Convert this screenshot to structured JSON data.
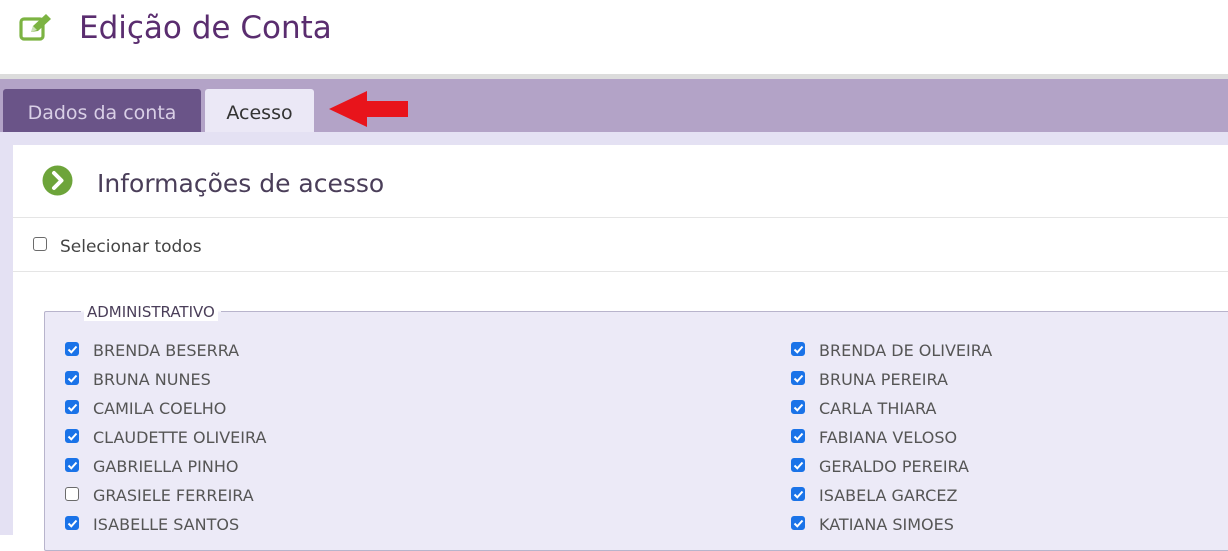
{
  "header": {
    "title": "Edição de Conta",
    "icon": "edit-icon"
  },
  "tabs": [
    {
      "label": "Dados da conta",
      "active": false
    },
    {
      "label": "Acesso",
      "active": true
    }
  ],
  "annotation": {
    "icon": "red-arrow-icon",
    "color": "#e8141b"
  },
  "section": {
    "title": "Informações de acesso",
    "icon": "chevron-circle-icon",
    "icon_color": "#6da43a"
  },
  "select_all": {
    "label": "Selecionar todos",
    "checked": false
  },
  "group": {
    "legend": "ADMINISTRATIVO",
    "left_column": [
      {
        "name": "BRENDA BESERRA",
        "checked": true
      },
      {
        "name": "BRUNA NUNES",
        "checked": true
      },
      {
        "name": "CAMILA COELHO",
        "checked": true
      },
      {
        "name": "CLAUDETTE OLIVEIRA",
        "checked": true
      },
      {
        "name": "GABRIELLA PINHO",
        "checked": true
      },
      {
        "name": "GRASIELE FERREIRA",
        "checked": false
      },
      {
        "name": "ISABELLE SANTOS",
        "checked": true
      }
    ],
    "right_column": [
      {
        "name": "BRENDA DE OLIVEIRA",
        "checked": true
      },
      {
        "name": "BRUNA PEREIRA",
        "checked": true
      },
      {
        "name": "CARLA THIARA",
        "checked": true
      },
      {
        "name": "FABIANA VELOSO",
        "checked": true
      },
      {
        "name": "GERALDO PEREIRA",
        "checked": true
      },
      {
        "name": "ISABELA GARCEZ",
        "checked": true
      },
      {
        "name": "KATIANA SIMOES",
        "checked": true
      }
    ]
  },
  "colors": {
    "title": "#5a2d6f",
    "tabbar": "#b3a3c7",
    "tab_inactive": "#6a5488",
    "checkbox": "#1a73e8"
  }
}
